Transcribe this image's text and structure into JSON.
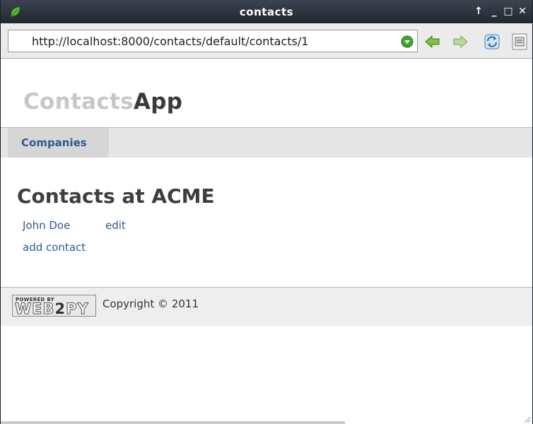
{
  "window": {
    "title": "contacts",
    "controls": {
      "maximize_up": "↑",
      "minimize": "_",
      "restore": "□",
      "close": "✕"
    },
    "icon": "leaf-app-icon"
  },
  "navbar": {
    "url": "http://localhost:8000/contacts/default/contacts/1",
    "buttons": [
      "go-icon",
      "back-arrow-icon",
      "forward-arrow-icon",
      "reload-icon",
      "page-info-icon"
    ]
  },
  "page": {
    "brand_light": "Contacts",
    "brand_dark": "App",
    "menu": {
      "items": [
        {
          "label": "Companies"
        }
      ]
    },
    "heading": "Contacts at ACME",
    "contacts": [
      {
        "name": "John Doe",
        "edit_label": "edit"
      }
    ],
    "add_contact_label": "add contact",
    "footer": {
      "badge_small": "POWERED BY",
      "badge_web": "WEB",
      "badge_two": "2",
      "badge_py": "PY",
      "copyright": "Copyright © 2011"
    }
  },
  "colors": {
    "link": "#2e5a8c",
    "titlebar_top": "#3a4350",
    "titlebar_bottom": "#222830",
    "menubar": "#e6e6e6",
    "menu_active": "#d6d6d6",
    "footer": "#eeeeee"
  }
}
